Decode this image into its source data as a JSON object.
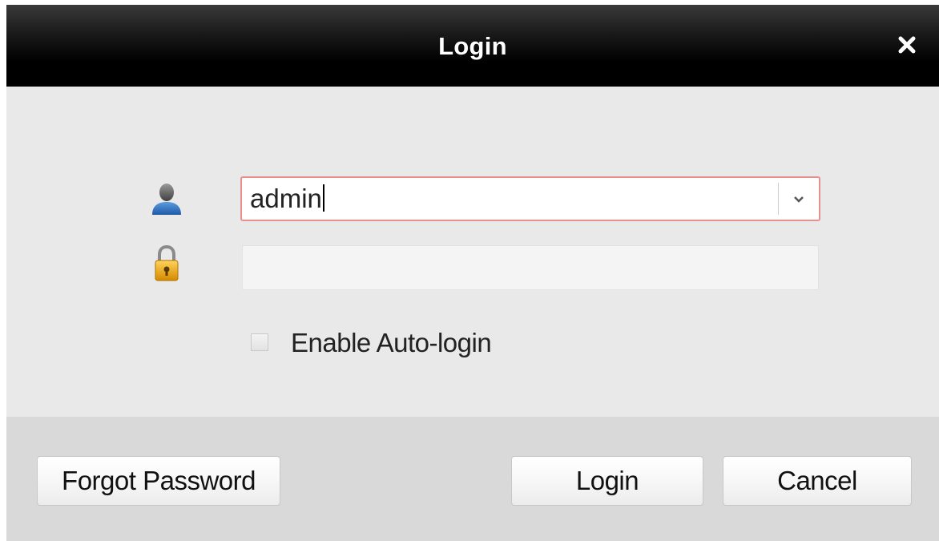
{
  "window": {
    "title": "Login",
    "close_glyph": "✕"
  },
  "icons": {
    "user": "user-icon",
    "password": "lock-icon",
    "dropdown": "chevron-down-icon"
  },
  "form": {
    "username": {
      "value": "admin"
    },
    "password": {
      "value": ""
    },
    "auto_login": {
      "label": "Enable Auto-login",
      "checked": false
    }
  },
  "buttons": {
    "forgot_password": "Forgot Password",
    "login": "Login",
    "cancel": "Cancel"
  },
  "colors": {
    "titlebar": "#000000",
    "body": "#e9e9e9",
    "footer": "#d9d9d9",
    "focus_border": "#e88f8f",
    "user_icon": "#2f6fb8",
    "lock_icon": "#e6a516"
  }
}
